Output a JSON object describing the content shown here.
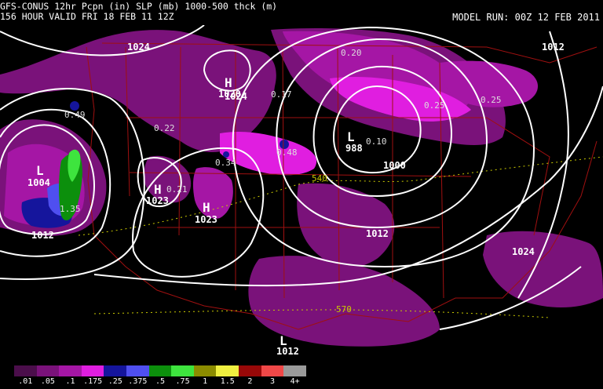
{
  "header": {
    "line1": "GFS-CONUS 12hr Pcpn (in) SLP (mb) 1000-500 thck (m)",
    "line2": "156 HOUR VALID FRI 18 FEB 11 12Z",
    "model_run": "MODEL RUN: 00Z 12 FEB 2011"
  },
  "map": {
    "pressure_labels": [
      "1024",
      "1012",
      "1020",
      "1024",
      "1004",
      "1012",
      "1023",
      "1023",
      "988",
      "1000",
      "1012",
      "1024",
      "1012"
    ],
    "center_symbols": [
      "L",
      "H",
      "H",
      "H",
      "L",
      "L"
    ],
    "precip_labels": [
      "0.49",
      "0.22",
      "0.21",
      "0.34",
      "0.48",
      "0.17",
      "0.20",
      "0.25",
      "0.25",
      "0.10",
      "1.35"
    ],
    "thickness_labels": [
      "540",
      "570"
    ]
  },
  "legend": {
    "items": [
      {
        "label": ".01",
        "color": "#4b0e4b"
      },
      {
        "label": ".05",
        "color": "#7a127a"
      },
      {
        "label": ".1",
        "color": "#a516a5"
      },
      {
        "label": ".175",
        "color": "#e01ee0"
      },
      {
        "label": ".25",
        "color": "#15159c"
      },
      {
        "label": ".375",
        "color": "#4f4ff0"
      },
      {
        "label": ".5",
        "color": "#0c8f0c"
      },
      {
        "label": ".75",
        "color": "#3ee43e"
      },
      {
        "label": "1",
        "color": "#8c8c00"
      },
      {
        "label": "1.5",
        "color": "#f0f040"
      },
      {
        "label": "2",
        "color": "#980808"
      },
      {
        "label": "3",
        "color": "#f04848"
      },
      {
        "label": "4+",
        "color": "#9a9a9a"
      }
    ]
  }
}
